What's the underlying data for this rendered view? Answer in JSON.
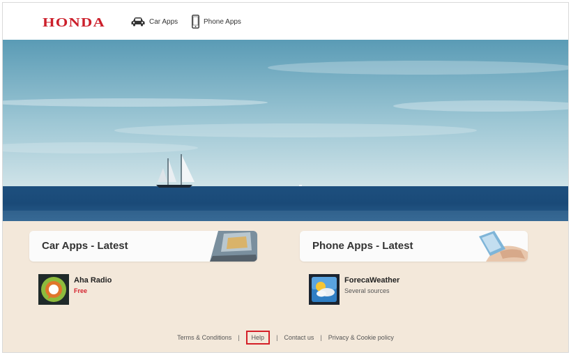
{
  "brand": {
    "name": "HONDA",
    "color": "#cc1f2b"
  },
  "nav": {
    "items": [
      {
        "label": "Car Apps",
        "icon": "car-icon"
      },
      {
        "label": "Phone Apps",
        "icon": "phone-icon"
      }
    ]
  },
  "sections": {
    "car": {
      "title": "Car Apps - Latest",
      "app": {
        "name": "Aha Radio",
        "subtitle": "Free",
        "icon": "aha-radio-icon"
      }
    },
    "phone": {
      "title": "Phone Apps - Latest",
      "app": {
        "name": "ForecaWeather",
        "subtitle": "Several sources",
        "icon": "foreca-weather-icon"
      }
    }
  },
  "footer": {
    "links": {
      "terms": "Terms & Conditions",
      "help": "Help",
      "contact": "Contact us",
      "privacy": "Privacy & Cookie policy"
    },
    "separator": "|"
  },
  "colors": {
    "background": "#f3e8da",
    "accent_red": "#d41f27"
  }
}
